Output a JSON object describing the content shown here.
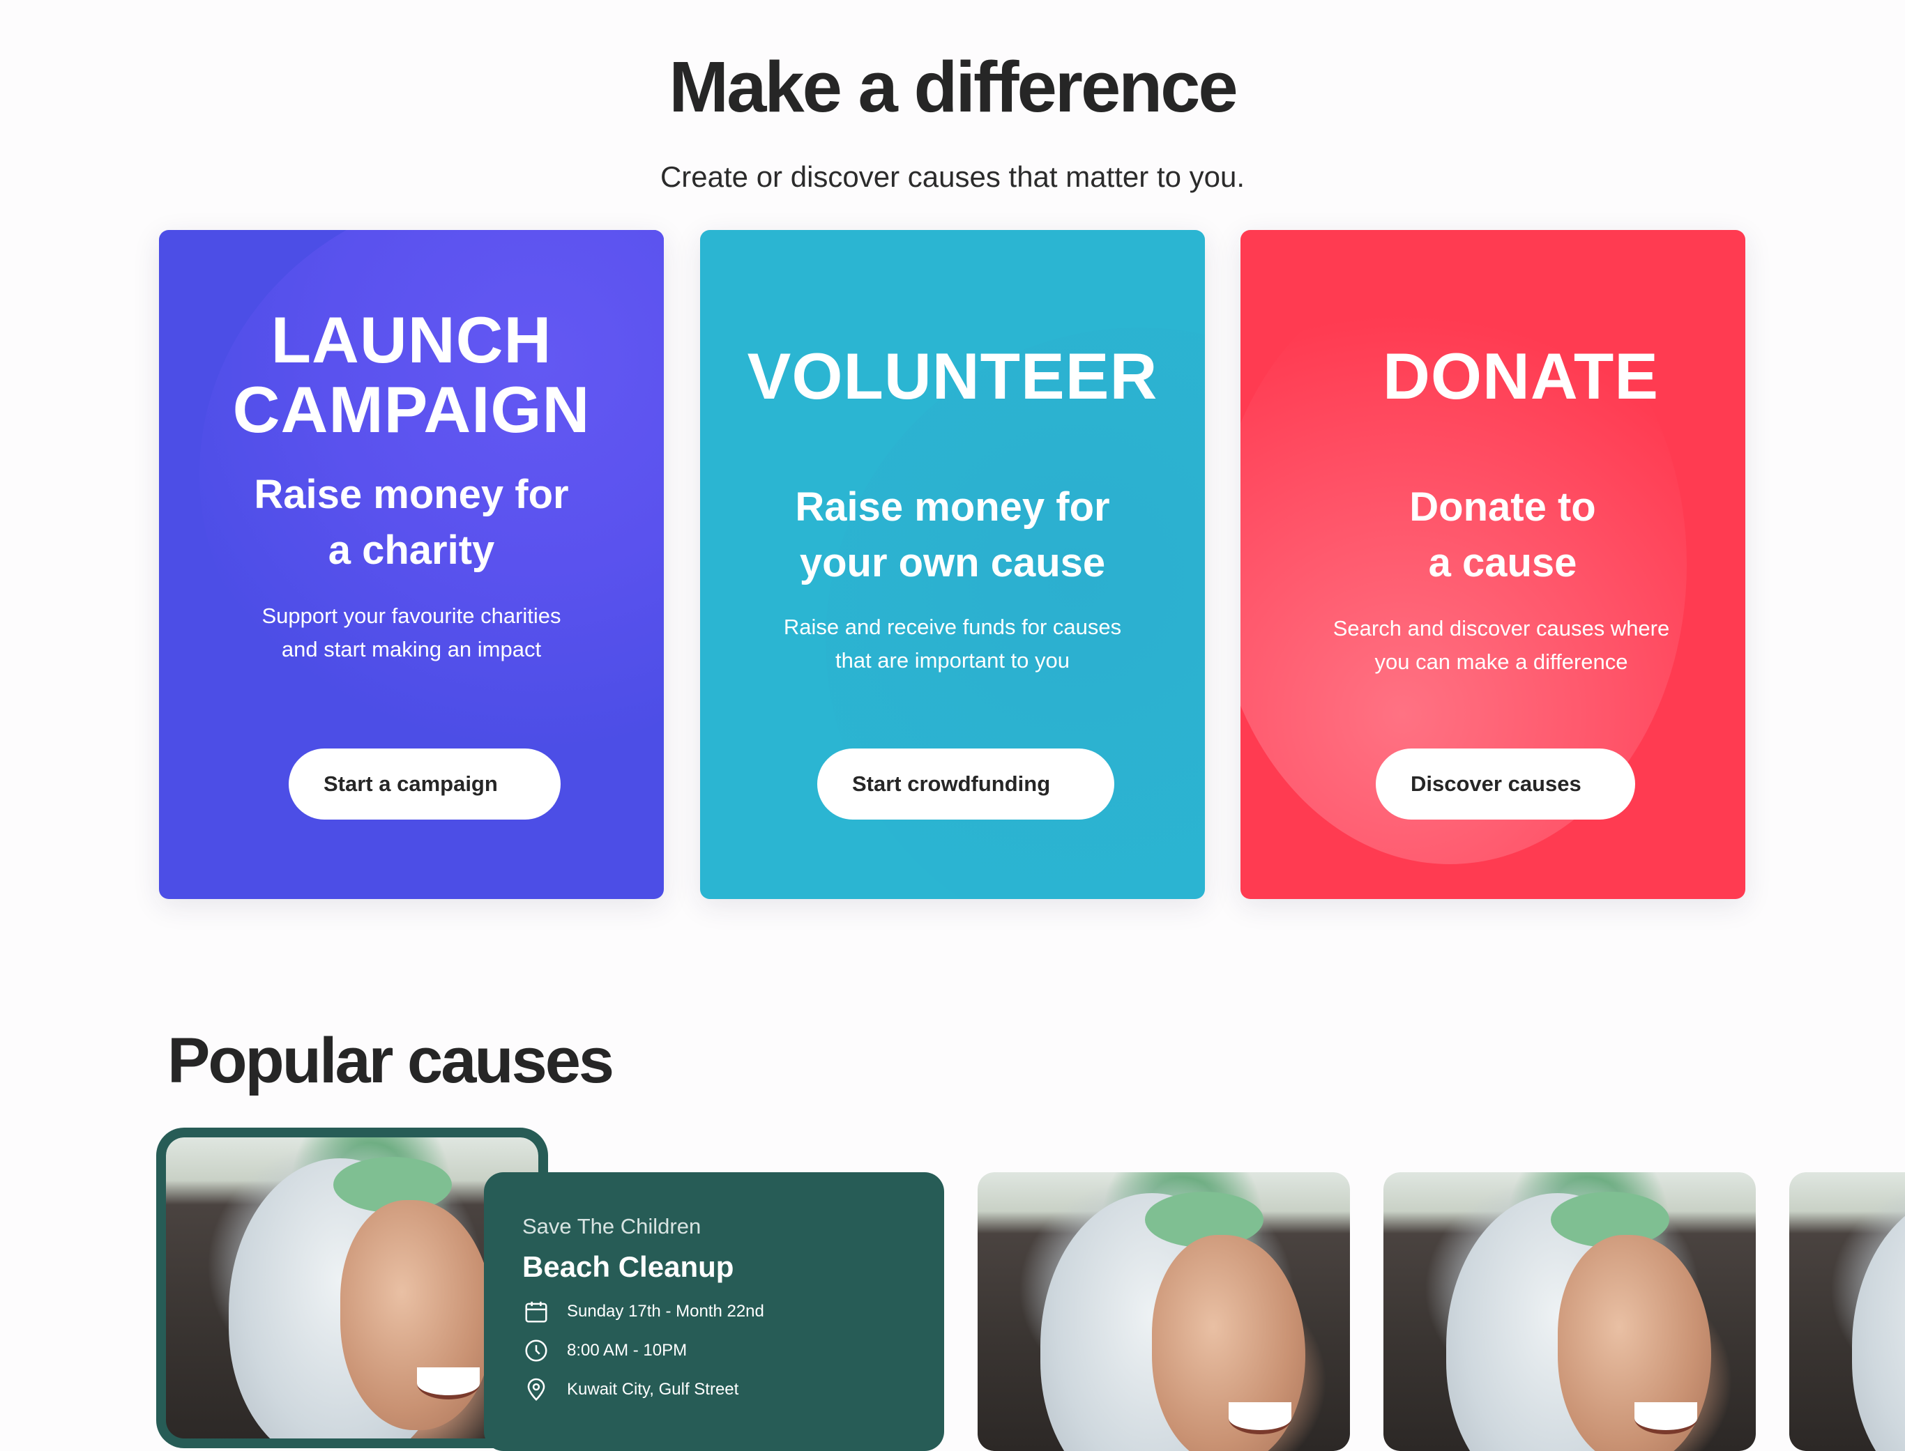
{
  "hero": {
    "title": "Make a difference",
    "subtitle": "Create or discover causes that matter to you."
  },
  "cards": {
    "launch": {
      "heading_line1": "LAUNCH",
      "heading_line2": "CAMPAIGN",
      "sub_line1": "Raise money for",
      "sub_line2": "a charity",
      "desc_line1": "Support your favourite charities",
      "desc_line2": "and start making an impact",
      "button": "Start a campaign",
      "color": "#4c4ee6"
    },
    "volunteer": {
      "heading": "VOLUNTEER",
      "sub_line1": "Raise money for",
      "sub_line2": "your own cause",
      "desc_line1": "Raise and receive funds for causes",
      "desc_line2": "that are important to you",
      "button": "Start crowdfunding",
      "color": "#2bb5d2"
    },
    "donate": {
      "heading": "DONATE",
      "sub_line1": "Donate to",
      "sub_line2": "a cause",
      "desc_line1": "Search and discover causes where",
      "desc_line2": "you can make a difference",
      "button": "Discover causes",
      "color": "#ff3b51"
    }
  },
  "popular": {
    "title": "Popular causes",
    "featured": {
      "organization": "Save The Children",
      "title": "Beach Cleanup",
      "date": "Sunday 17th - Month 22nd",
      "time": "8:00 AM - 10PM",
      "location": "Kuwait City, Gulf Street",
      "icons": [
        "calendar-icon",
        "clock-icon",
        "location-pin-icon"
      ],
      "panel_color": "#275c56"
    }
  }
}
